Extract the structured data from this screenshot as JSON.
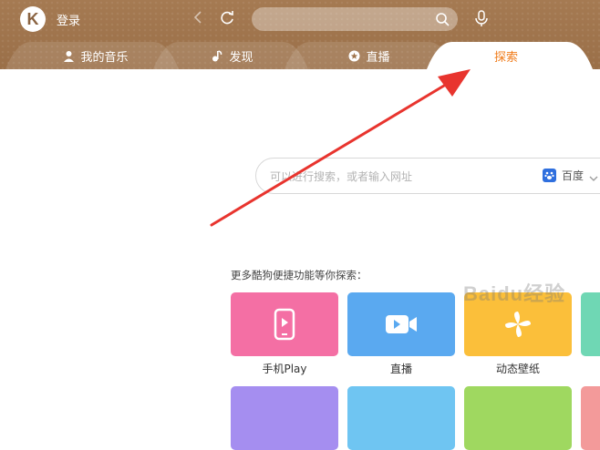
{
  "header": {
    "logo_letter": "K",
    "login_label": "登录",
    "search_placeholder": "",
    "icons": {
      "back": "chevron-left-icon",
      "refresh": "refresh-icon",
      "search": "search-icon",
      "mic": "microphone-icon"
    }
  },
  "tabs": [
    {
      "label": "我的音乐",
      "icon": "user-icon",
      "active": false
    },
    {
      "label": "发现",
      "icon": "music-note-icon",
      "active": false
    },
    {
      "label": "直播",
      "icon": "star-icon",
      "active": false
    },
    {
      "label": "探索",
      "icon": "",
      "active": true
    }
  ],
  "explore": {
    "search_placeholder": "可以进行搜索，或者输入网址",
    "engine_label": "百度",
    "more_label": "更多酷狗便捷功能等你探索：",
    "tiles": [
      {
        "label": "手机Play",
        "icon": "phone-play-icon",
        "color": "#f46fa4"
      },
      {
        "label": "直播",
        "icon": "video-camera-icon",
        "color": "#5aa9f0"
      },
      {
        "label": "动态壁纸",
        "icon": "pinwheel-icon",
        "color": "#fbbf3a"
      }
    ]
  },
  "watermark": "Baidu经验",
  "colors": {
    "header_brown": "#9f744c",
    "active_tab_text": "#f07b1a",
    "annotation_arrow": "#e8342e"
  }
}
